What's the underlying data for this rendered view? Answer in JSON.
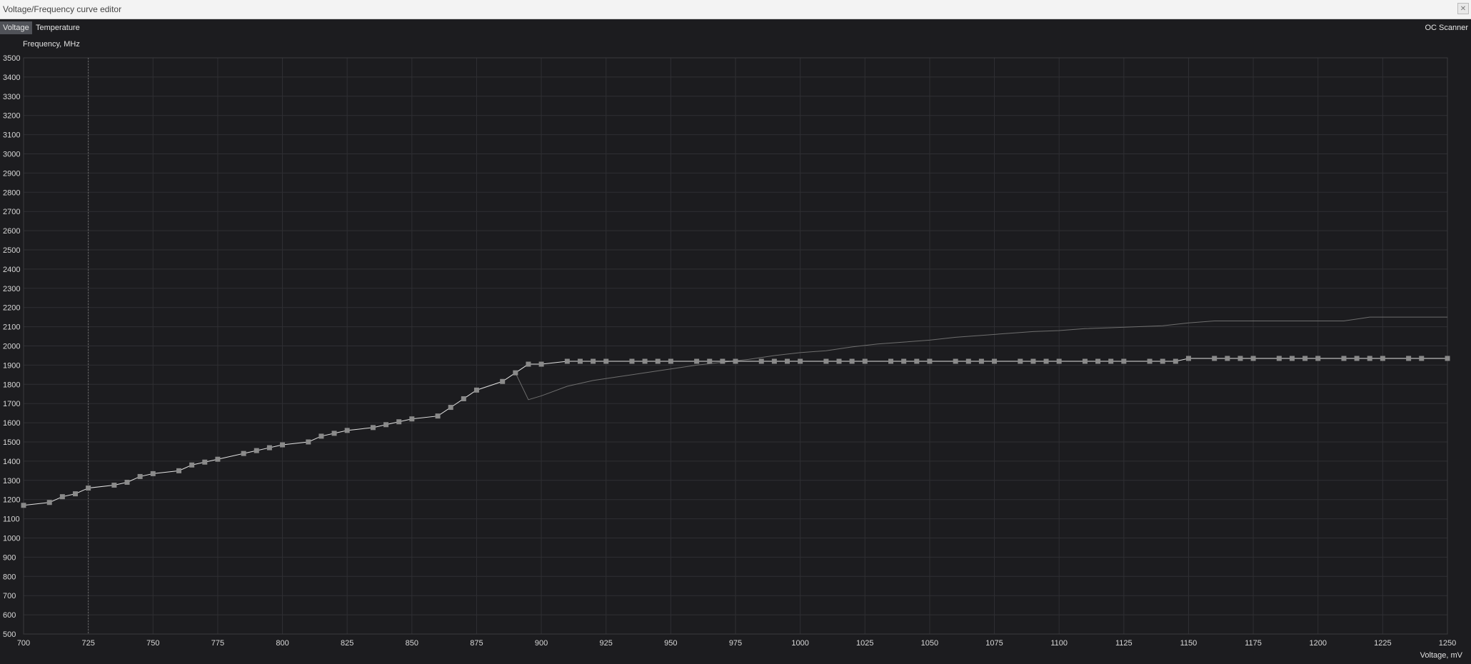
{
  "window": {
    "title": "Voltage/Frequency curve editor",
    "close_glyph": "✕"
  },
  "tabs": [
    {
      "label": "Voltage",
      "active": true
    },
    {
      "label": "Temperature",
      "active": false
    }
  ],
  "oc_scanner_label": "OC Scanner",
  "chart_data": {
    "type": "line",
    "xlabel": "Voltage, mV",
    "ylabel": "Frequency, MHz",
    "xlim": [
      700,
      1250
    ],
    "ylim": [
      500,
      3500
    ],
    "x_ticks": [
      700,
      725,
      750,
      775,
      800,
      825,
      850,
      875,
      900,
      925,
      950,
      975,
      1000,
      1025,
      1050,
      1075,
      1100,
      1125,
      1150,
      1175,
      1200,
      1225,
      1250
    ],
    "y_ticks": [
      500,
      600,
      700,
      800,
      900,
      1000,
      1100,
      1200,
      1300,
      1400,
      1500,
      1600,
      1700,
      1800,
      1900,
      2000,
      2100,
      2200,
      2300,
      2400,
      2500,
      2600,
      2700,
      2800,
      2900,
      3000,
      3100,
      3200,
      3300,
      3400,
      3500
    ],
    "grid": true,
    "cursor_voltage": 725,
    "colors": {
      "curve": "#e2e2e2",
      "points": "#8a8a8a",
      "default_curve": "#6e6e6e",
      "grid": "#2f2f33",
      "cursor": "#6a6a6a"
    },
    "series": [
      {
        "x": [
          700,
          710,
          715,
          720,
          725,
          735,
          740,
          745,
          750,
          760,
          765,
          770,
          775,
          785,
          790,
          795,
          800,
          810,
          815,
          820,
          825,
          835,
          840,
          845,
          850,
          860,
          865,
          870,
          875,
          885,
          890,
          895,
          900,
          910,
          915,
          920,
          925,
          935,
          940,
          945,
          950,
          960,
          965,
          970,
          975,
          985,
          990,
          995,
          1000,
          1010,
          1015,
          1020,
          1025,
          1035,
          1040,
          1045,
          1050,
          1060,
          1065,
          1070,
          1075,
          1085,
          1090,
          1095,
          1100,
          1110,
          1115,
          1120,
          1125,
          1135,
          1140,
          1145,
          1150,
          1160,
          1165,
          1170,
          1175,
          1185,
          1190,
          1195,
          1200,
          1210,
          1215,
          1220,
          1225,
          1235,
          1240,
          1250
        ],
        "y": [
          1170,
          1185,
          1215,
          1230,
          1260,
          1275,
          1290,
          1320,
          1335,
          1350,
          1380,
          1395,
          1410,
          1440,
          1455,
          1470,
          1485,
          1500,
          1530,
          1545,
          1560,
          1575,
          1590,
          1605,
          1620,
          1635,
          1680,
          1725,
          1770,
          1815,
          1860,
          1905,
          1905,
          1920,
          1920,
          1920,
          1920,
          1920,
          1920,
          1920,
          1920,
          1920,
          1920,
          1920,
          1920,
          1920,
          1920,
          1920,
          1920,
          1920,
          1920,
          1920,
          1920,
          1920,
          1920,
          1920,
          1920,
          1920,
          1920,
          1920,
          1920,
          1920,
          1920,
          1920,
          1920,
          1920,
          1920,
          1920,
          1920,
          1920,
          1920,
          1920,
          1935,
          1935,
          1935,
          1935,
          1935,
          1935,
          1935,
          1935,
          1935,
          1935,
          1935,
          1935,
          1935,
          1935,
          1935,
          1935
        ],
        "markers": true
      },
      {
        "x": [
          890,
          895,
          900,
          910,
          920,
          930,
          940,
          950,
          960,
          970,
          980,
          990,
          1000,
          1010,
          1020,
          1030,
          1040,
          1050,
          1060,
          1070,
          1080,
          1090,
          1100,
          1110,
          1120,
          1130,
          1140,
          1150,
          1160,
          1170,
          1180,
          1190,
          1200,
          1210,
          1220,
          1230,
          1240,
          1250
        ],
        "y": [
          1860,
          1720,
          1740,
          1790,
          1820,
          1840,
          1860,
          1880,
          1900,
          1915,
          1930,
          1950,
          1965,
          1975,
          1995,
          2010,
          2020,
          2030,
          2045,
          2055,
          2065,
          2075,
          2080,
          2090,
          2095,
          2100,
          2105,
          2120,
          2130,
          2130,
          2130,
          2130,
          2130,
          2130,
          2150,
          2150,
          2150,
          2150
        ],
        "markers": false
      }
    ]
  }
}
